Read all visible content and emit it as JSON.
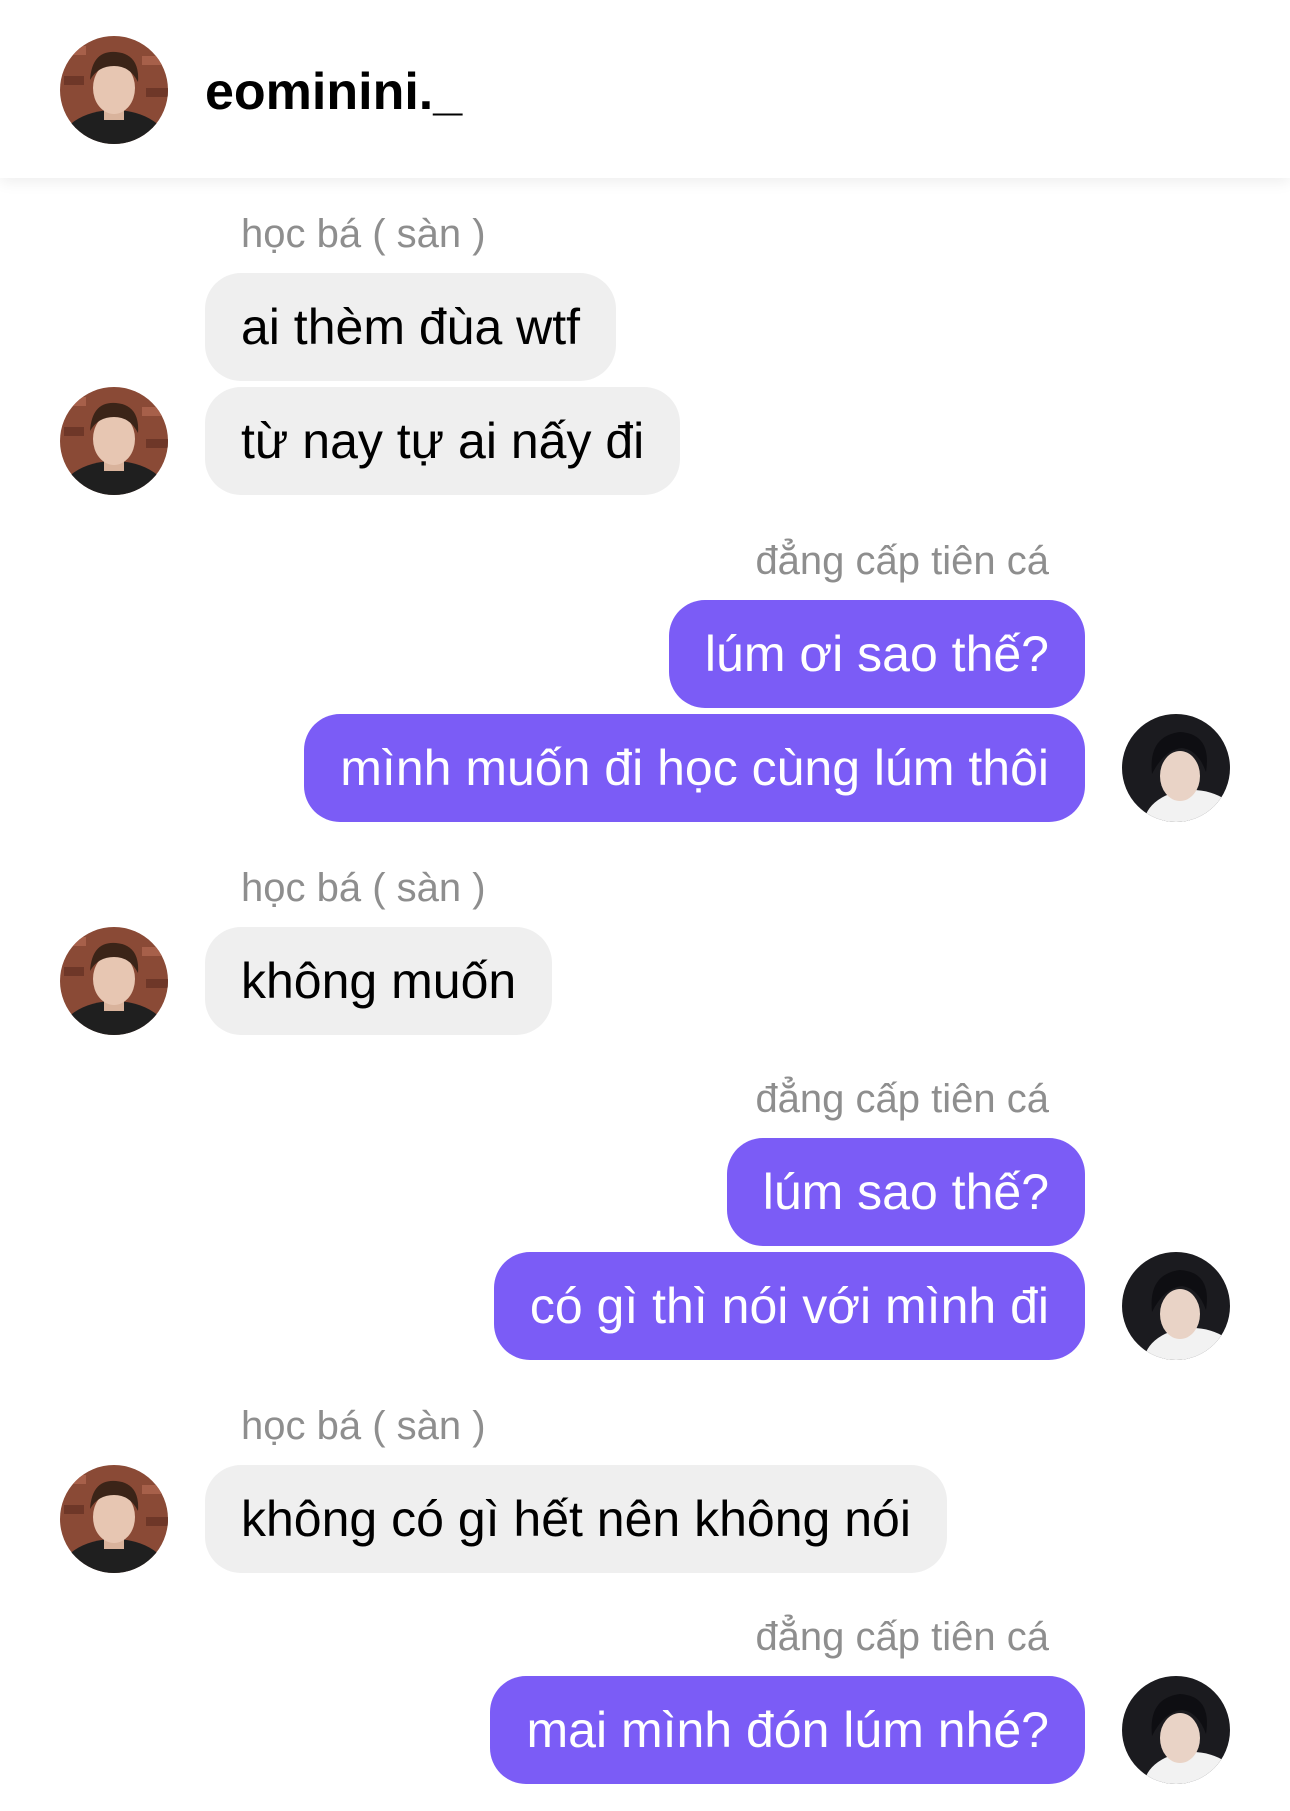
{
  "header": {
    "username": "eominini._",
    "avatar_icon": "profile-photo-icon"
  },
  "colors": {
    "outgoing_bubble": "#7b5cf6",
    "incoming_bubble": "#efefef",
    "sender_label": "#8e8e8e"
  },
  "messages": [
    {
      "side": "left",
      "sender": "học bá ( sàn )",
      "bubbles": [
        "ai thèm đùa wtf",
        "từ nay tự ai nấy đi"
      ]
    },
    {
      "side": "right",
      "sender": "đẳng cấp tiên cá",
      "bubbles": [
        "lúm ơi sao thế?",
        "mình muốn đi học cùng lúm thôi"
      ]
    },
    {
      "side": "left",
      "sender": "học bá ( sàn )",
      "bubbles": [
        "không muốn"
      ]
    },
    {
      "side": "right",
      "sender": "đẳng cấp tiên cá",
      "bubbles": [
        "lúm sao thế?",
        "có gì thì nói với mình đi"
      ]
    },
    {
      "side": "left",
      "sender": "học bá ( sàn )",
      "bubbles": [
        "không có gì hết nên không nói"
      ]
    },
    {
      "side": "right",
      "sender": "đẳng cấp tiên cá",
      "bubbles": [
        "mai mình đón lúm nhé?"
      ]
    }
  ]
}
